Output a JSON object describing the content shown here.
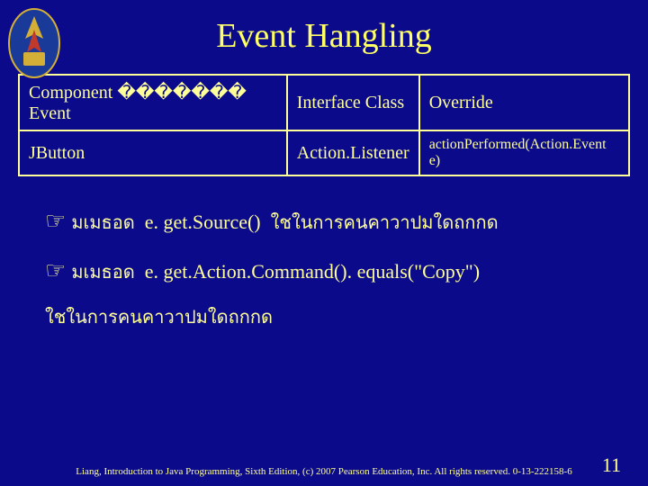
{
  "title": "Event Hangling",
  "table": {
    "r0c0": "Component ������� Event",
    "r0c1": "Interface Class",
    "r0c2": "Override",
    "r1c0": "JButton",
    "r1c1": "Action.Listener",
    "r1c2": "actionPerformed(Action.Event e)"
  },
  "bullets": {
    "b1_pre": "มเมธอด",
    "b1_code": "e. get.Source()",
    "b1_post": "ใชในการคนคาวาปมใดถกกด",
    "b2_pre": "มเมธอด",
    "b2_code": "e. get.Action.Command(). equals(\"Copy\")",
    "b3": "ใชในการคนคาวาปมใดถกกด"
  },
  "footer": "Liang, Introduction to Java Programming, Sixth Edition, (c) 2007 Pearson Education, Inc. All rights reserved. 0-13-222158-6",
  "page": "11"
}
